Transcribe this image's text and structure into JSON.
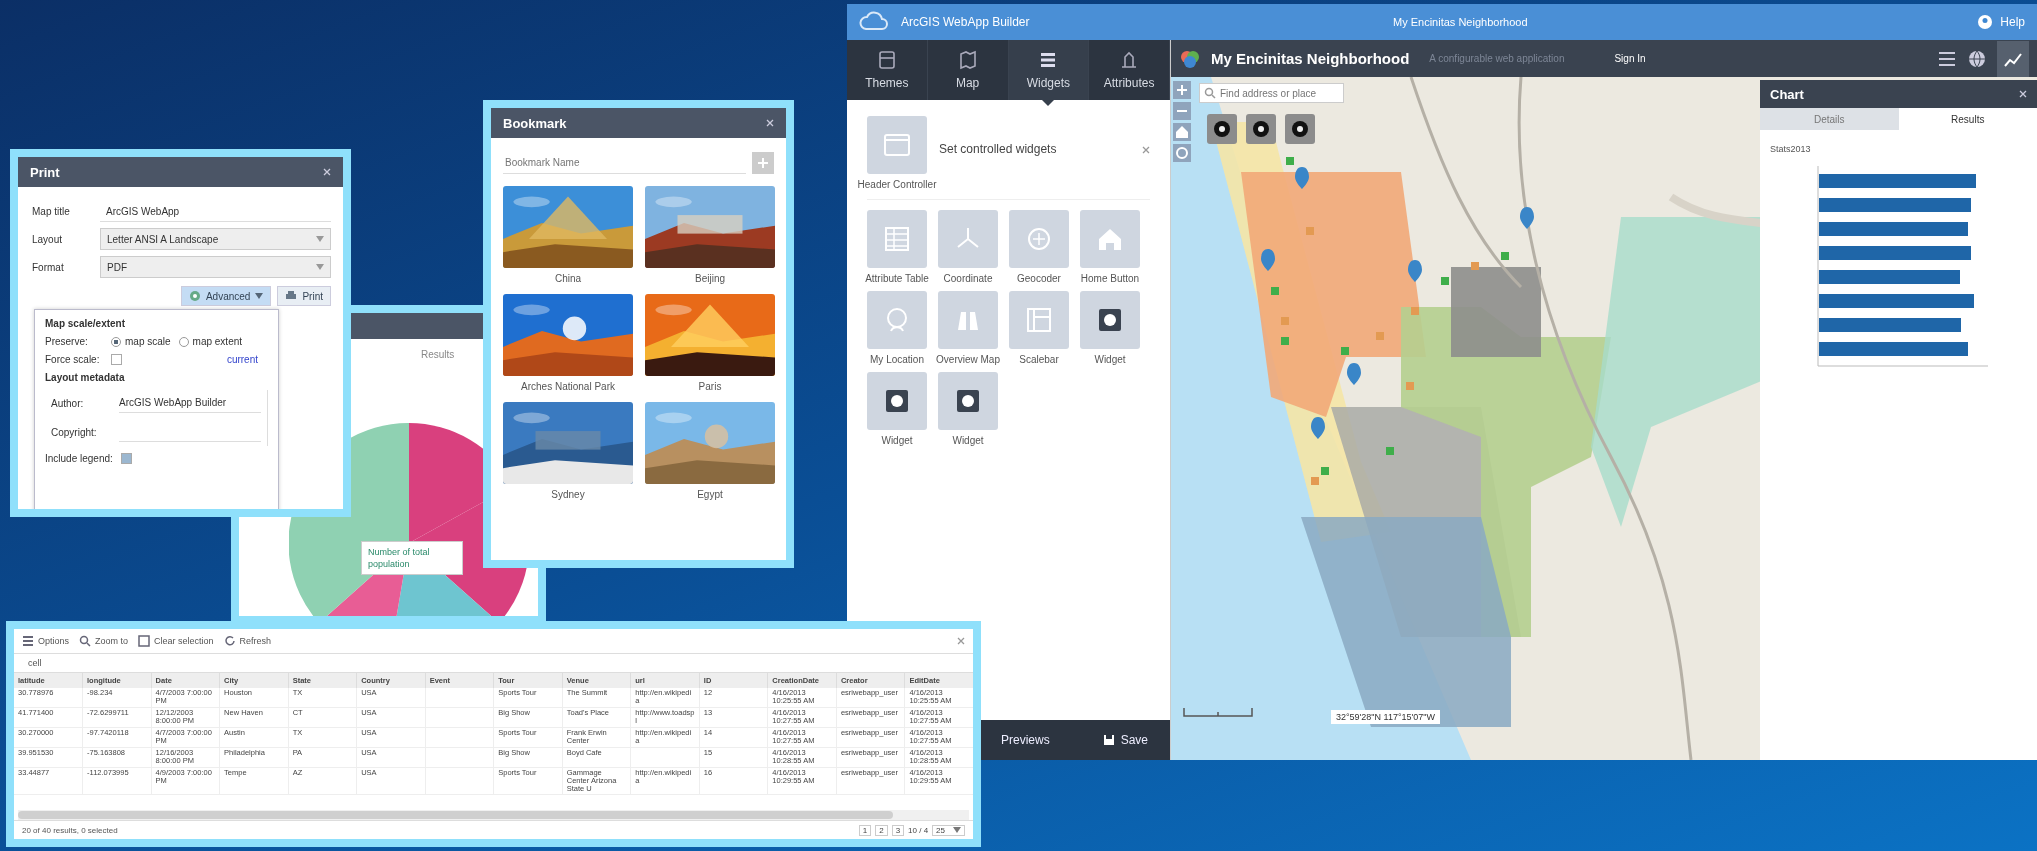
{
  "print_panel": {
    "title": "Print",
    "fields": [
      {
        "label": "Map title",
        "value": "ArcGIS WebApp",
        "kind": "text"
      },
      {
        "label": "Layout",
        "value": "Letter ANSI A Landscape",
        "kind": "select"
      },
      {
        "label": "Format",
        "value": "PDF",
        "kind": "select"
      }
    ],
    "advanced_button": {
      "label": "Advanced",
      "expanded": true
    },
    "print_button": "Print",
    "advanced": {
      "heading": "Map scale/extent",
      "preserve_label": "Preserve:",
      "options": [
        {
          "label": "map scale",
          "selected": true
        },
        {
          "label": "map extent",
          "selected": false
        }
      ],
      "force_scale": {
        "label": "Force scale:",
        "checked": false
      },
      "current_link": "current",
      "metadata_heading": "Layout metadata",
      "metadata": [
        {
          "label": "Author:",
          "value": "ArcGIS WebApp Builder"
        },
        {
          "label": "Copyright:"
        }
      ],
      "include_legend": {
        "label": "Include legend:",
        "checked": true
      }
    }
  },
  "chart_window": {
    "tab": "Results",
    "tooltip": "Number of total population"
  },
  "bookmark": {
    "title": "Bookmark",
    "search_placeholder": "Bookmark Name",
    "items": [
      {
        "label": "China",
        "kind": "picture"
      },
      {
        "label": "Beijing",
        "kind": "picture"
      },
      {
        "label": "Arches National Park",
        "kind": "picture"
      },
      {
        "label": "Paris",
        "kind": "picture"
      },
      {
        "label": "Sydney",
        "kind": "picture"
      },
      {
        "label": "Egypt",
        "kind": "picture"
      }
    ]
  },
  "table": {
    "toolbar": [
      "Options",
      "Zoom to",
      "Clear selection",
      "Refresh"
    ],
    "tab": "cell",
    "columns": [
      "latitude",
      "longitude",
      "Date",
      "City",
      "State",
      "Country",
      "Event",
      "Tour",
      "Venue",
      "url",
      "ID",
      "CreationDate",
      "Creator",
      "EditDate"
    ],
    "rows": [
      [
        "30.778976",
        "-98.234",
        "4/7/2003 7:00:00 PM",
        "Houston",
        "TX",
        "USA",
        null,
        "Sports Tour",
        "The Summit",
        "http://en.wikipedia",
        "12",
        "4/16/2013 10:25:55 AM",
        "esriwebapp_user",
        "4/16/2013 10:25:55 AM"
      ],
      [
        "41.771400",
        "-72.6299711",
        "12/12/2003 8:00:00 PM",
        "New Haven",
        "CT",
        "USA",
        null,
        "Big Show",
        "Toad's Place",
        "http://www.toadspl",
        "13",
        "4/16/2013 10:27:55 AM",
        "esriwebapp_user",
        "4/16/2013 10:27:55 AM"
      ],
      [
        "30.270000",
        "-97.7420118",
        "4/7/2003 7:00:00 PM",
        "Austin",
        "TX",
        "USA",
        null,
        "Sports Tour",
        "Frank Erwin Center",
        "http://en.wikipedia",
        "14",
        "4/16/2013 10:27:55 AM",
        "esriwebapp_user",
        "4/16/2013 10:27:55 AM"
      ],
      [
        "39.951530",
        "-75.163808",
        "12/16/2003 8:00:00 PM",
        "Philadelphia",
        "PA",
        "USA",
        null,
        "Big Show",
        "Boyd Cafe",
        null,
        "15",
        "4/16/2013 10:28:55 AM",
        "esriwebapp_user",
        "4/16/2013 10:28:55 AM"
      ],
      [
        "33.44877",
        "-112.073995",
        "4/9/2003 7:00:00 PM",
        "Tempe",
        "AZ",
        "USA",
        null,
        "Sports Tour",
        "Gammage Center Arizona State U",
        "http://en.wikipedia",
        "16",
        "4/16/2013 10:29:55 AM",
        "esriwebapp_user",
        "4/16/2013 10:29:55 AM"
      ]
    ],
    "status": "20 of 40 results, 0 selected",
    "pages": [
      "1",
      "2",
      "3"
    ],
    "page_info": "10 / 4",
    "page_size": "25"
  },
  "builder": {
    "window_title": "ArcGIS WebApp Builder",
    "app_name": "My Encinitas Neighborhood",
    "help": "Help",
    "nav_tabs": [
      {
        "label": "Themes",
        "kind": "themes",
        "selected": false
      },
      {
        "label": "Map",
        "kind": "map",
        "selected": false
      },
      {
        "label": "Widgets",
        "kind": "widgets",
        "selected": true
      },
      {
        "label": "Attributes",
        "kind": "attributes",
        "selected": false
      }
    ],
    "header_controller": {
      "label": "Header Controller",
      "text": "Set controlled widgets"
    },
    "widgets": [
      {
        "label": "Attribute Table",
        "kind": "table"
      },
      {
        "label": "Coordinate",
        "kind": "coordinate"
      },
      {
        "label": "Geocoder",
        "kind": "geocoder"
      },
      {
        "label": "Home Button",
        "kind": "home"
      },
      {
        "label": "My Location",
        "kind": "location"
      },
      {
        "label": "Overview Map",
        "kind": "binoculars"
      },
      {
        "label": "Scalebar",
        "kind": "scalebar"
      },
      {
        "label": "Widget",
        "kind": "placeholder"
      },
      {
        "label": "Widget",
        "kind": "placeholder"
      },
      {
        "label": "Widget",
        "kind": "placeholder"
      }
    ],
    "footer": {
      "preview": "Previews",
      "save": "Save"
    },
    "app_header": {
      "title": "My Encinitas Neighborhood",
      "subtitle": "A configurable web application",
      "sign_in": "Sign In"
    },
    "map": {
      "search_placeholder": "Find address or place",
      "coordinates": "32°59'28\"N 117°15'07\"W"
    },
    "chart_panel": {
      "title": "Chart",
      "tabs": [
        {
          "label": "Details",
          "selected": false
        },
        {
          "label": "Results",
          "selected": true
        }
      ],
      "series_label": "Stats2013"
    }
  }
}
